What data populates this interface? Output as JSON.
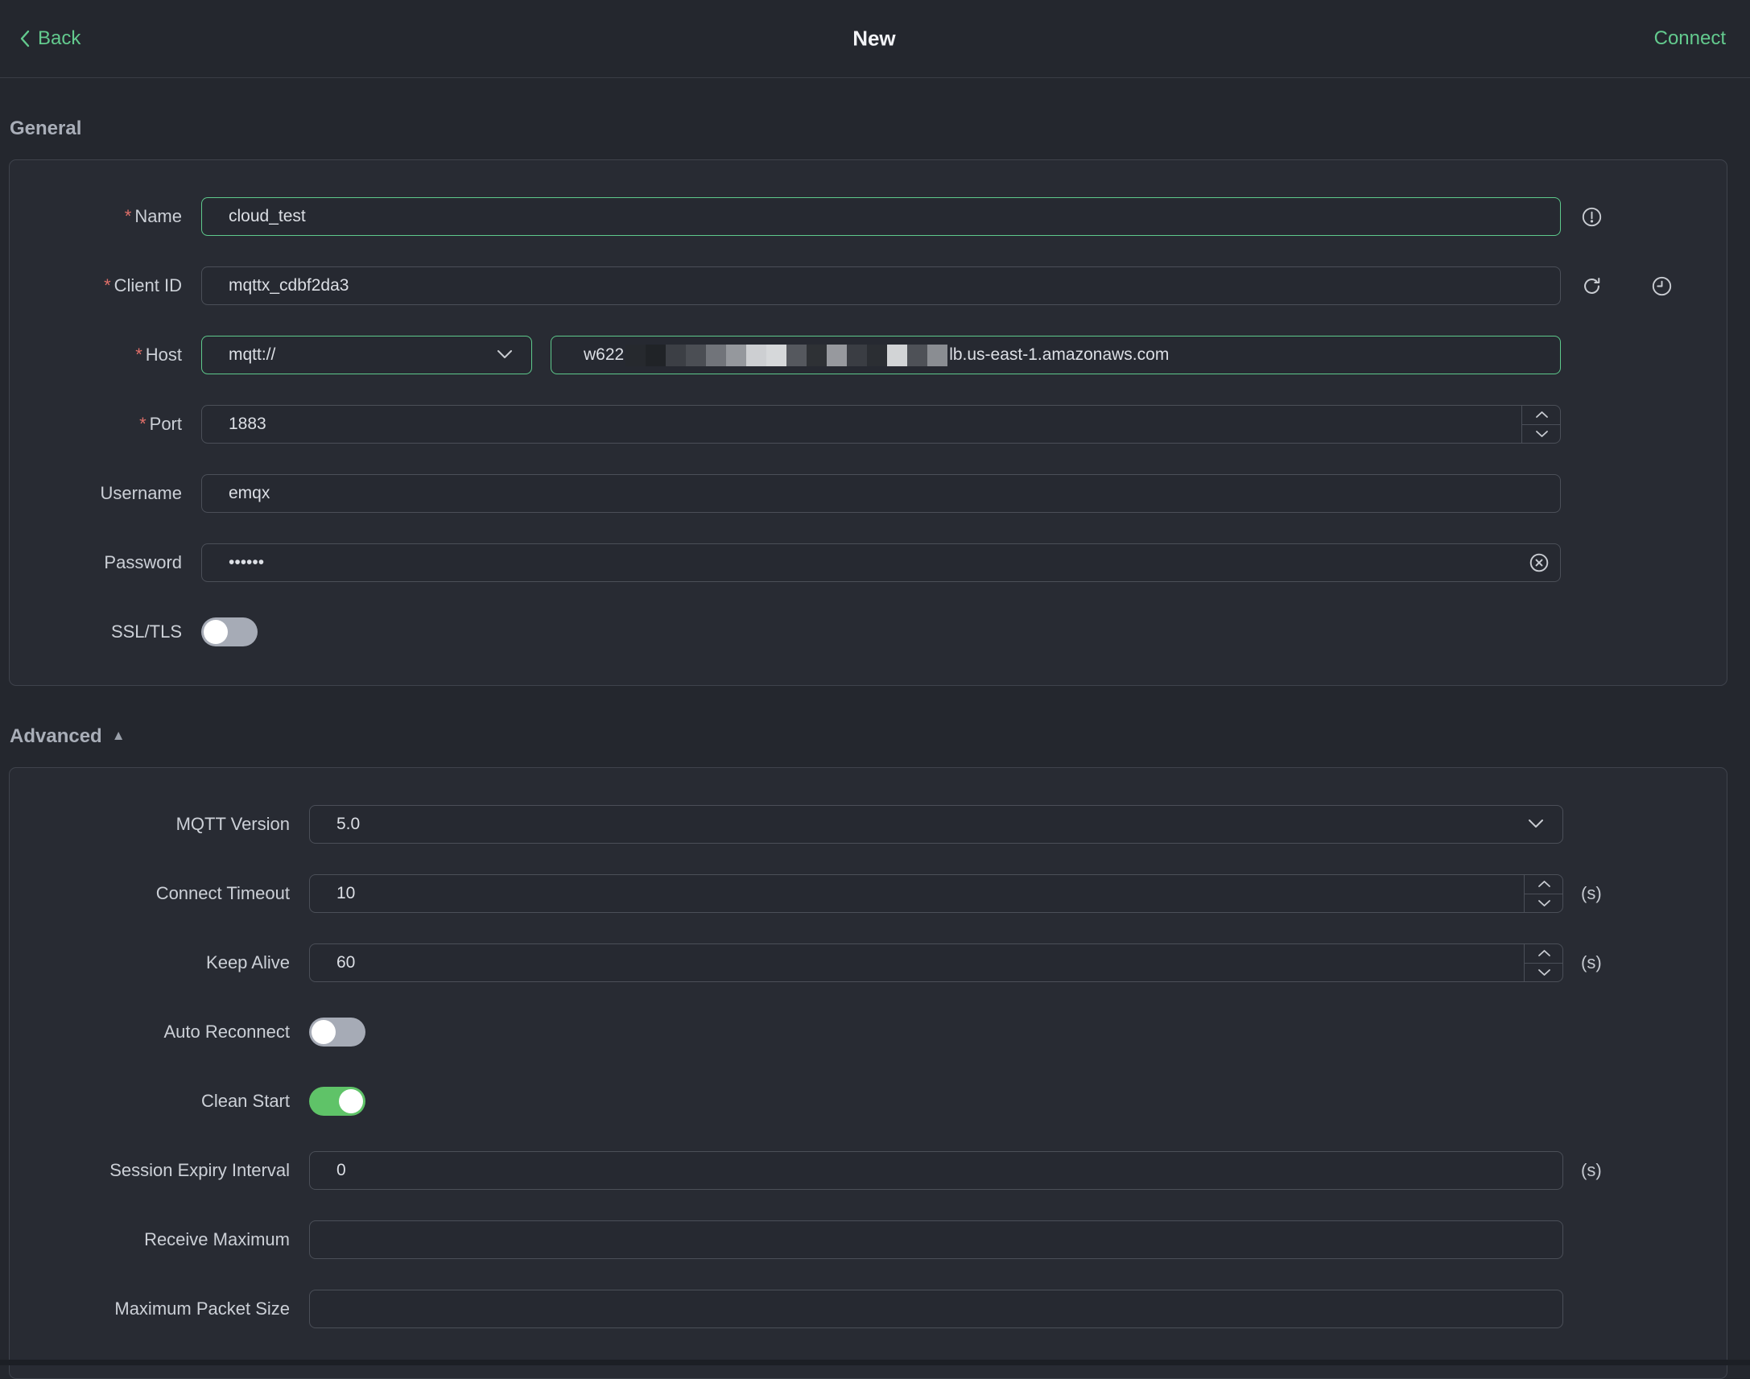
{
  "topbar": {
    "back_label": "Back",
    "title": "New",
    "connect_label": "Connect"
  },
  "colors": {
    "accent_text": "#63ca8e",
    "accent_border": "#5ec98c",
    "toggle_on": "#5fc368",
    "required_asterisk": "#e06f69"
  },
  "required_mark": "*",
  "general": {
    "section_title": "General",
    "fields": {
      "name": {
        "label": "Name",
        "value": "cloud_test"
      },
      "client_id": {
        "label": "Client ID",
        "value": "mqttx_cdbf2da3"
      },
      "host": {
        "label": "Host",
        "protocol": "mqtt://",
        "value_prefix": "w622",
        "value_suffix": "lb.us-east-1.amazonaws.com",
        "redacted_blocks": [
          "#26292e",
          "#202327",
          "#3c3f45",
          "#4b4e54",
          "#71747a",
          "#95989d",
          "#cdcfd2",
          "#d6d8da",
          "#55585e",
          "#2e3135",
          "#97999e",
          "#3a3d43",
          "#2b2e33",
          "#d2d4d6",
          "#4e5157",
          "#8a8d92"
        ]
      },
      "port": {
        "label": "Port",
        "value": "1883"
      },
      "username": {
        "label": "Username",
        "value": "emqx"
      },
      "password": {
        "label": "Password",
        "value": "••••••"
      },
      "ssl": {
        "label": "SSL/TLS",
        "enabled": false
      }
    }
  },
  "advanced": {
    "section_title": "Advanced",
    "collapse_icon": "▲",
    "fields": {
      "mqtt_version": {
        "label": "MQTT Version",
        "value": "5.0"
      },
      "connect_timeout": {
        "label": "Connect Timeout",
        "value": "10",
        "unit": "(s)"
      },
      "keep_alive": {
        "label": "Keep Alive",
        "value": "60",
        "unit": "(s)"
      },
      "auto_reconnect": {
        "label": "Auto Reconnect",
        "enabled": false
      },
      "clean_start": {
        "label": "Clean Start",
        "enabled": true
      },
      "session_expiry": {
        "label": "Session Expiry Interval",
        "value": "0",
        "unit": "(s)"
      },
      "receive_maximum": {
        "label": "Receive Maximum",
        "value": ""
      },
      "maximum_packet_size": {
        "label": "Maximum Packet Size",
        "value": ""
      }
    }
  }
}
